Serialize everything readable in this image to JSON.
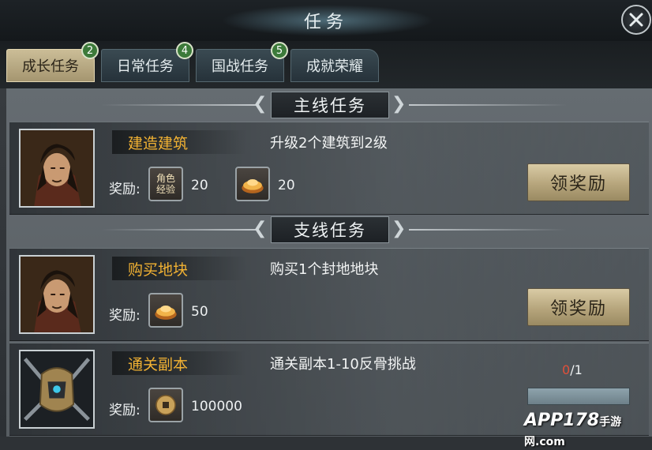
{
  "window": {
    "title": "任务"
  },
  "tabs": [
    {
      "label": "成长任务",
      "badge": "2",
      "active": true
    },
    {
      "label": "日常任务",
      "badge": "4",
      "active": false
    },
    {
      "label": "国战任务",
      "badge": "5",
      "active": false
    },
    {
      "label": "成就荣耀",
      "badge": "",
      "active": false
    }
  ],
  "sections": {
    "main": {
      "title": "主线任务"
    },
    "side": {
      "title": "支线任务"
    }
  },
  "quests": [
    {
      "name": "建造建筑",
      "description": "升级2个建筑到2级",
      "reward_label": "奖励:",
      "rewards": [
        {
          "icon": "role-exp-icon",
          "icon_text_1": "角色",
          "icon_text_2": "经验",
          "qty": "20"
        },
        {
          "icon": "gold-ingot-icon",
          "qty": "20"
        }
      ],
      "button_label": "领奖励"
    },
    {
      "name": "购买地块",
      "description": "购买1个封地地块",
      "reward_label": "奖励:",
      "rewards": [
        {
          "icon": "gold-ingot-icon",
          "qty": "50"
        }
      ],
      "button_label": "领奖励"
    },
    {
      "name": "通关副本",
      "description": "通关副本1-10反骨挑战",
      "reward_label": "奖励:",
      "rewards": [
        {
          "icon": "copper-coin-icon",
          "qty": "100000"
        }
      ],
      "progress": {
        "current": "0",
        "total": "/1"
      }
    }
  ],
  "watermark": {
    "brand": "APP178",
    "sub": "手游网",
    "domain": ".com"
  },
  "colors": {
    "quest_name": "#f2b233",
    "progress_current": "#e0503a",
    "tab_active": "#cbbd97",
    "badge": "#3c7a3a"
  }
}
